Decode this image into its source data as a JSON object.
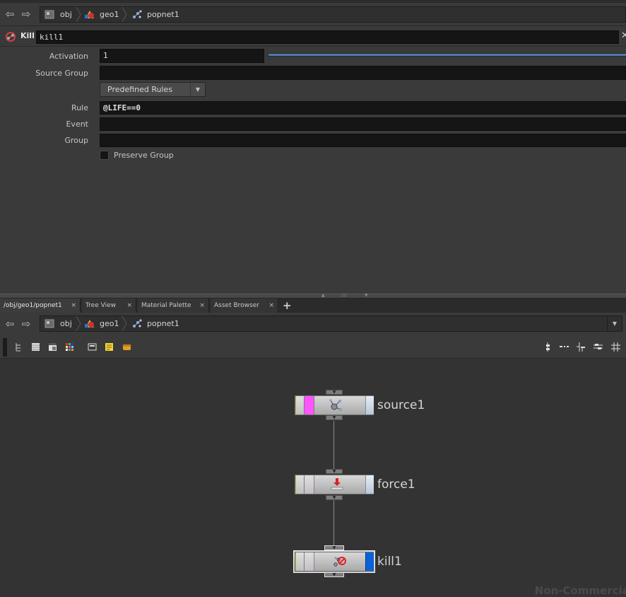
{
  "top_path": {
    "crumbs": [
      {
        "label": "obj",
        "icon": "obj-icon"
      },
      {
        "label": "geo1",
        "icon": "geo-icon"
      },
      {
        "label": "popnet1",
        "icon": "popnet-icon"
      }
    ]
  },
  "node_header": {
    "type_label": "Kill",
    "name_value": "kill1"
  },
  "params": {
    "activation": {
      "label": "Activation",
      "value": "1"
    },
    "source_group": {
      "label": "Source Group",
      "value": ""
    },
    "predefined_rules": {
      "label": "Predefined Rules"
    },
    "rule": {
      "label": "Rule",
      "value": "@LIFE==0"
    },
    "event": {
      "label": "Event",
      "value": ""
    },
    "group": {
      "label": "Group",
      "value": ""
    },
    "preserve_group": {
      "label": "Preserve Group",
      "checked": false
    }
  },
  "tabs": [
    {
      "label": "/obj/geo1/popnet1",
      "active": true
    },
    {
      "label": "Tree View",
      "active": false
    },
    {
      "label": "Material Palette",
      "active": false
    },
    {
      "label": "Asset Browser",
      "active": false
    }
  ],
  "tab_close_glyph": "×",
  "tab_add_glyph": "+",
  "network_path": {
    "crumbs": [
      {
        "label": "obj",
        "icon": "obj-icon"
      },
      {
        "label": "geo1",
        "icon": "geo-icon"
      },
      {
        "label": "popnet1",
        "icon": "popnet-icon"
      }
    ]
  },
  "network": {
    "nodes": [
      {
        "name": "source1",
        "icon": "source-icon",
        "selected": false,
        "display_flag": false,
        "bypass_color": "#ff55ff"
      },
      {
        "name": "force1",
        "icon": "force-icon",
        "selected": false,
        "display_flag": false,
        "bypass_color": ""
      },
      {
        "name": "kill1",
        "icon": "kill-icon",
        "selected": true,
        "display_flag": true,
        "bypass_color": ""
      }
    ],
    "watermark": "Non-Commercial"
  },
  "colors": {
    "display_flag_blue": "#0a62d6",
    "bypass_pink": "#ff55ff",
    "activation_bar": "#5577aa"
  }
}
